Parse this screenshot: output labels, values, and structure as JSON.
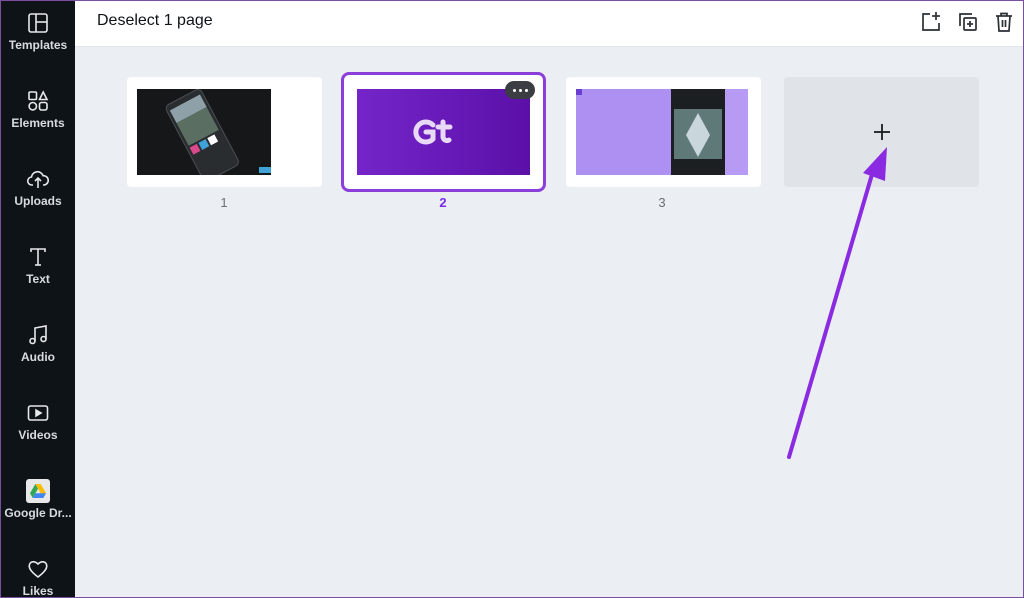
{
  "sidebar": {
    "items": [
      {
        "label": "Templates",
        "icon": "templates-icon"
      },
      {
        "label": "Elements",
        "icon": "elements-icon"
      },
      {
        "label": "Uploads",
        "icon": "upload-cloud-icon"
      },
      {
        "label": "Text",
        "icon": "text-icon"
      },
      {
        "label": "Audio",
        "icon": "music-note-icon"
      },
      {
        "label": "Videos",
        "icon": "video-icon"
      },
      {
        "label": "Google Dr...",
        "icon": "google-drive-icon"
      },
      {
        "label": "Likes",
        "icon": "heart-icon"
      }
    ]
  },
  "header": {
    "title": "Deselect 1 page",
    "actions": [
      "add-page-icon",
      "duplicate-page-icon",
      "trash-icon"
    ]
  },
  "pages": [
    {
      "number": "1",
      "selected": false
    },
    {
      "number": "2",
      "selected": true,
      "logo_text": "Gt"
    },
    {
      "number": "3",
      "selected": false
    }
  ],
  "add_page": {
    "symbol": "+"
  },
  "colors": {
    "sidebar_bg": "#0e1318",
    "canvas_bg": "#ebeef2",
    "accent": "#8b3ed8",
    "arrow": "#8a2be2"
  }
}
